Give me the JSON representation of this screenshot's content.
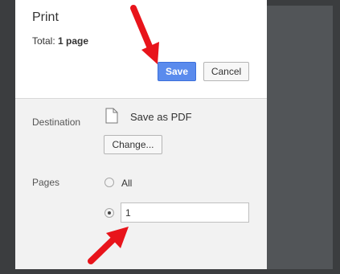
{
  "dialog": {
    "title": "Print",
    "total_label": "Total:",
    "total_value": "1 page"
  },
  "actions": {
    "save_label": "Save",
    "cancel_label": "Cancel"
  },
  "destination": {
    "label": "Destination",
    "value": "Save as PDF",
    "change_label": "Change..."
  },
  "pages": {
    "label": "Pages",
    "all_label": "All",
    "range_value": "1",
    "selected": "range"
  },
  "colors": {
    "save_button": "#5a8bed",
    "annotation_arrow": "#e8141b",
    "background": "#3b3d3f"
  },
  "annotations": [
    "arrow-pointing-to-save-button",
    "arrow-pointing-to-pages-input"
  ]
}
